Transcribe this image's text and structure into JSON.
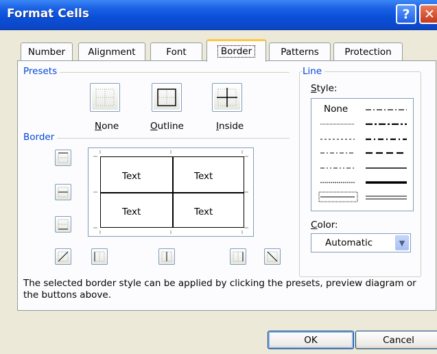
{
  "window": {
    "title": "Format Cells"
  },
  "titlebar_buttons": {
    "help_label": "?",
    "close_label": "✕"
  },
  "tabs": [
    {
      "label": "Number"
    },
    {
      "label": "Alignment"
    },
    {
      "label": "Font"
    },
    {
      "label": "Border",
      "active": true
    },
    {
      "label": "Patterns"
    },
    {
      "label": "Protection"
    }
  ],
  "presets": {
    "group_label": "Presets",
    "buttons": [
      {
        "mnemonic": "N",
        "rest": "one"
      },
      {
        "mnemonic": "O",
        "rest": "utline"
      },
      {
        "mnemonic": "I",
        "rest": "nside"
      }
    ]
  },
  "border": {
    "group_label": "Border"
  },
  "preview": {
    "cells": [
      "Text",
      "Text",
      "Text",
      "Text"
    ]
  },
  "line": {
    "group_label": "Line",
    "style_label": {
      "mnemonic": "S",
      "rest": "tyle:"
    },
    "none_label": "None",
    "color_label": {
      "mnemonic": "C",
      "rest": "olor:"
    },
    "color_value": "Automatic"
  },
  "info_text": "The selected border style can be applied by clicking the presets, preview diagram or the buttons above.",
  "buttons": {
    "ok": "OK",
    "cancel": "Cancel"
  },
  "colors": {
    "title_bar": "#0a4fd8",
    "group_label": "#0046d5",
    "dialog_bg": "#ece9d8",
    "tab_highlight": "#ffc83c"
  }
}
